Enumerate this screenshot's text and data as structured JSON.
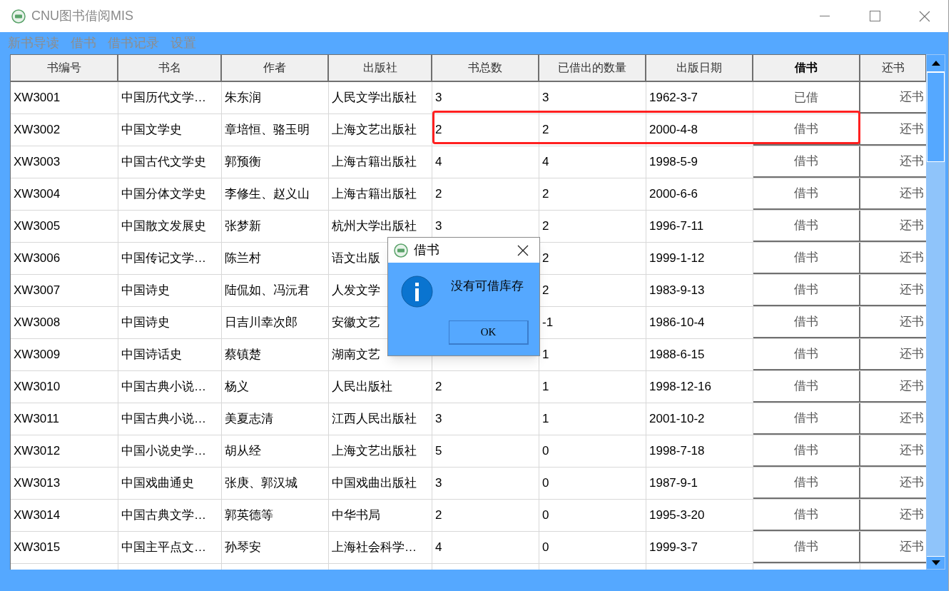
{
  "window": {
    "title": "CNU图书借阅MIS"
  },
  "menu": [
    "新书导读",
    "借书",
    "借书记录",
    "设置"
  ],
  "table": {
    "columns": [
      {
        "label": "书编号",
        "bold": false
      },
      {
        "label": "书名",
        "bold": false
      },
      {
        "label": "作者",
        "bold": false
      },
      {
        "label": "出版社",
        "bold": false
      },
      {
        "label": "书总数",
        "bold": false
      },
      {
        "label": "已借出的数量",
        "bold": false
      },
      {
        "label": "出版日期",
        "bold": false
      },
      {
        "label": "借书",
        "bold": true
      },
      {
        "label": "还书",
        "bold": false
      }
    ],
    "rows": [
      {
        "cells": [
          "XW3001",
          "中国历代文学…",
          "朱东润",
          "人民文学出版社",
          "3",
          "3",
          "1962-3-7"
        ],
        "borrow": {
          "label": "已借",
          "kind": "text"
        },
        "return": "还书",
        "highlighted": false
      },
      {
        "cells": [
          "XW3002",
          "中国文学史",
          "章培恒、骆玉明",
          "上海文艺出版社",
          "2",
          "2",
          "2000-4-8"
        ],
        "borrow": {
          "label": "借书",
          "kind": "button"
        },
        "return": "还书",
        "highlighted": true
      },
      {
        "cells": [
          "XW3003",
          "中国古代文学史",
          "郭预衡",
          "上海古籍出版社",
          "4",
          "4",
          "1998-5-9"
        ],
        "borrow": {
          "label": "借书",
          "kind": "button"
        },
        "return": "还书",
        "highlighted": false
      },
      {
        "cells": [
          "XW3004",
          "中国分体文学史",
          "李修生、赵义山",
          "上海古籍出版社",
          "2",
          "2",
          "2000-6-6"
        ],
        "borrow": {
          "label": "借书",
          "kind": "button"
        },
        "return": "还书",
        "highlighted": false
      },
      {
        "cells": [
          "XW3005",
          "中国散文发展史",
          "张梦新",
          "杭州大学出版社",
          "3",
          "2",
          "1996-7-11"
        ],
        "borrow": {
          "label": "借书",
          "kind": "button"
        },
        "return": "还书",
        "highlighted": false
      },
      {
        "cells": [
          "XW3006",
          "中国传记文学…",
          "陈兰村",
          "语文出版",
          null,
          "2",
          "1999-1-12"
        ],
        "borrow": {
          "label": "借书",
          "kind": "button"
        },
        "return": "还书",
        "highlighted": false
      },
      {
        "cells": [
          "XW3007",
          "中国诗史",
          "陆侃如、冯沅君",
          "人发文学",
          null,
          "2",
          "1983-9-13"
        ],
        "borrow": {
          "label": "借书",
          "kind": "button"
        },
        "return": "还书",
        "highlighted": false
      },
      {
        "cells": [
          "XW3008",
          "中国诗史",
          "日吉川幸次郎",
          "安徽文艺",
          null,
          "-1",
          "1986-10-4"
        ],
        "borrow": {
          "label": "借书",
          "kind": "button"
        },
        "return": "还书",
        "highlighted": false
      },
      {
        "cells": [
          "XW3009",
          "中国诗话史",
          "蔡镇楚",
          "湖南文艺",
          null,
          "1",
          "1988-6-15"
        ],
        "borrow": {
          "label": "借书",
          "kind": "button"
        },
        "return": "还书",
        "highlighted": false
      },
      {
        "cells": [
          "XW3010",
          "中国古典小说…",
          "杨义",
          "人民出版社",
          "2",
          "1",
          "1998-12-16"
        ],
        "borrow": {
          "label": "借书",
          "kind": "button"
        },
        "return": "还书",
        "highlighted": false
      },
      {
        "cells": [
          "XW3011",
          "中国古典小说…",
          "美夏志清",
          "江西人民出版社",
          "3",
          "1",
          "2001-10-2"
        ],
        "borrow": {
          "label": "借书",
          "kind": "button"
        },
        "return": "还书",
        "highlighted": false
      },
      {
        "cells": [
          "XW3012",
          "中国小说史学…",
          "胡从经",
          "上海文艺出版社",
          "5",
          "0",
          "1998-7-18"
        ],
        "borrow": {
          "label": "借书",
          "kind": "button"
        },
        "return": "还书",
        "highlighted": false
      },
      {
        "cells": [
          "XW3013",
          "中国戏曲通史",
          "张庚、郭汉城",
          "中国戏曲出版社",
          "3",
          "0",
          "1987-9-1"
        ],
        "borrow": {
          "label": "借书",
          "kind": "button"
        },
        "return": "还书",
        "highlighted": false
      },
      {
        "cells": [
          "XW3014",
          "中国古典文学…",
          "郭英德等",
          "中华书局",
          "2",
          "0",
          "1995-3-20"
        ],
        "borrow": {
          "label": "借书",
          "kind": "button"
        },
        "return": "还书",
        "highlighted": false
      },
      {
        "cells": [
          "XW3015",
          "中国主平点文…",
          "孙琴安",
          "上海社会科学…",
          "4",
          "0",
          "1999-3-7"
        ],
        "borrow": {
          "label": "借书",
          "kind": "button"
        },
        "return": "还书",
        "highlighted": false
      }
    ]
  },
  "dialog": {
    "title": "借书",
    "message": "没有可借库存",
    "button": "OK"
  }
}
